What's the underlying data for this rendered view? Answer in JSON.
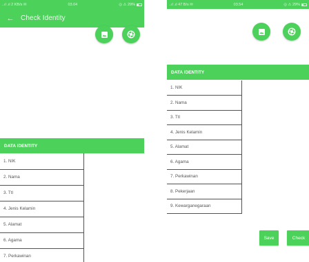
{
  "left_screen": {
    "status_bar": {
      "left": "..ıl .ıl 2 KB/s ✉",
      "time": "03.04",
      "right": "◎ ⚠ 29%"
    },
    "title": "Check Identity",
    "section_title": "DATA IDENTITY",
    "rows": [
      {
        "label": "1. NIK",
        "value": ""
      },
      {
        "label": "2. Nama",
        "value": ""
      },
      {
        "label": "3. Ttl",
        "value": ""
      },
      {
        "label": "4. Jenis Kelamin",
        "value": ""
      },
      {
        "label": "5. Alamat",
        "value": ""
      },
      {
        "label": "6. Agama",
        "value": ""
      },
      {
        "label": "7. Perkawinan",
        "value": ""
      }
    ]
  },
  "right_screen": {
    "status_bar": {
      "left": "..ıl .ıl 47 B/s ✉",
      "time": "03.54",
      "right": "◎ ⚠ 29%"
    },
    "section_title": "DATA IDENTITY",
    "rows": [
      {
        "label": "1. NIK",
        "value": ""
      },
      {
        "label": "2. Nama",
        "value": ""
      },
      {
        "label": "3. Ttl",
        "value": ""
      },
      {
        "label": "4. Jenis Kelamin",
        "value": ""
      },
      {
        "label": "5. Alamat",
        "value": ""
      },
      {
        "label": "6. Agama",
        "value": ""
      },
      {
        "label": "7. Perkawinan",
        "value": ""
      },
      {
        "label": "8. Pekerjaan",
        "value": ""
      },
      {
        "label": "9. Kewarganegaraan",
        "value": ""
      }
    ],
    "buttons": {
      "save": "Save",
      "check": "Check"
    }
  },
  "icons": {
    "back": "arrow-left-icon",
    "gallery": "image-gallery-icon",
    "camera": "camera-shutter-icon"
  },
  "colors": {
    "primary_green": "#4cd15a",
    "text_gray": "#555555",
    "divider": "#505050"
  }
}
